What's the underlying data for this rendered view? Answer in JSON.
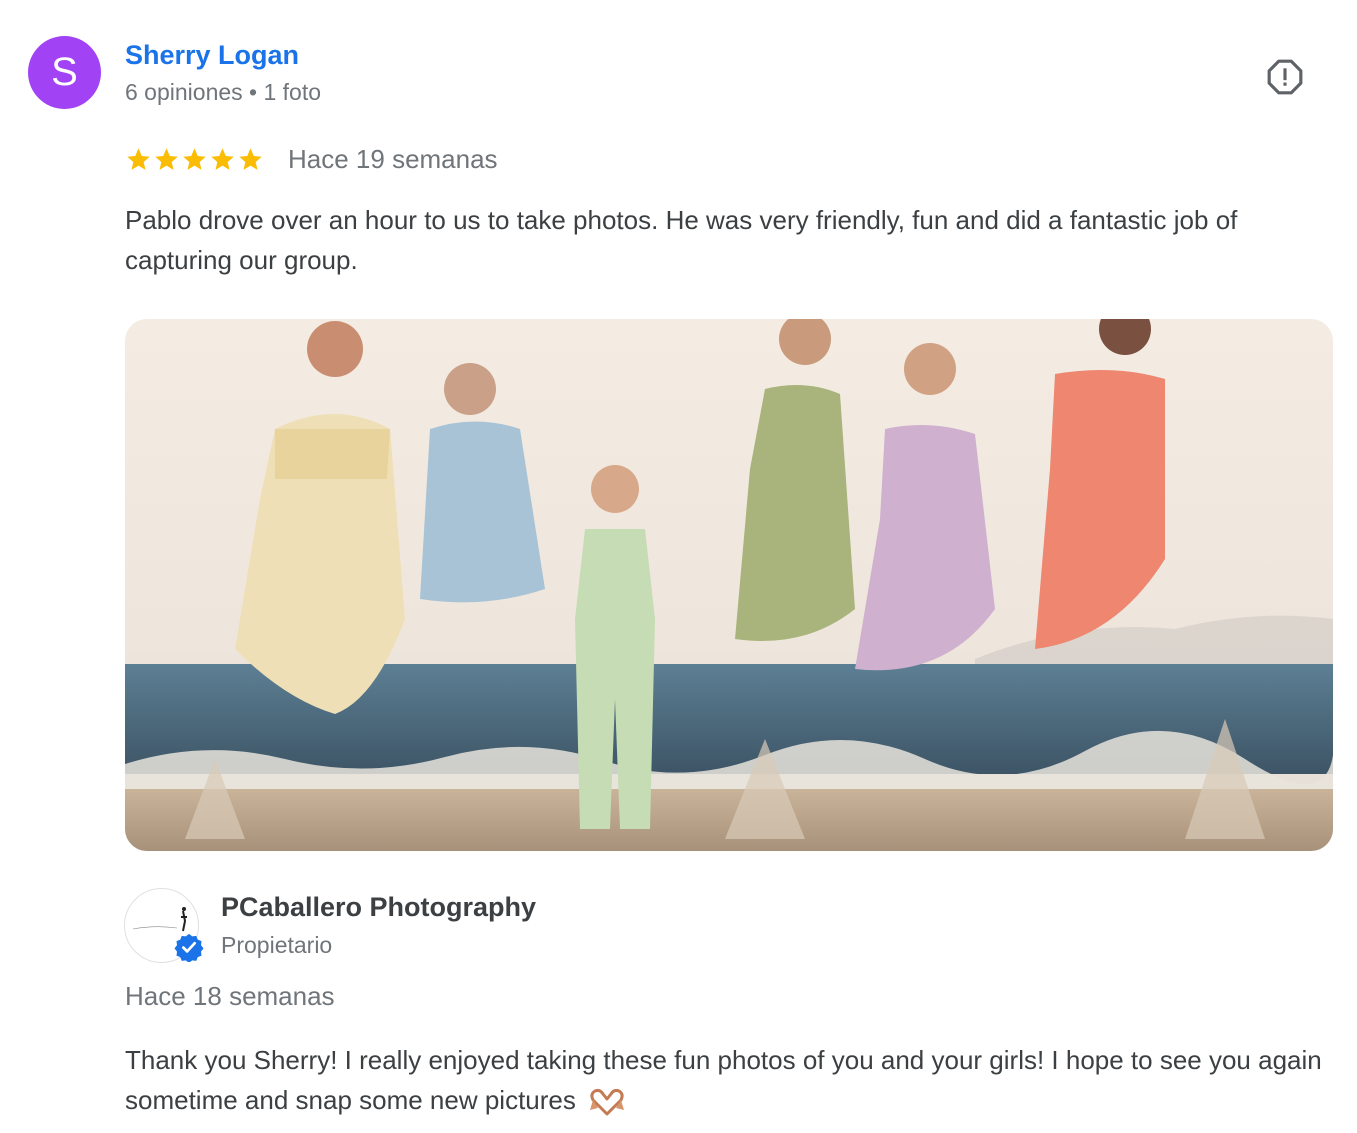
{
  "reviewer": {
    "initial": "S",
    "name": "Sherry Logan",
    "meta": "6 opiniones • 1 foto",
    "avatar_color": "#a142f4"
  },
  "review": {
    "rating": 5,
    "max_rating": 5,
    "time": "Hace 19 semanas",
    "text": "Pablo drove over an hour to us to take photos. He was very friendly, fun and did a fantastic job of capturing our group."
  },
  "report_icon": "report-flag-icon",
  "photo": {
    "icon": "review-photo"
  },
  "owner_reply": {
    "owner_name": "PCaballero Photography",
    "role": "Propietario",
    "time": "Hace 18 semanas",
    "text": "Thank you Sherry! I really enjoyed taking these fun photos of you and your girls! I hope to see you again sometime and snap some new pictures",
    "emoji_icon": "heart-hands-icon",
    "verified_icon": "verified-badge-icon"
  },
  "colors": {
    "link_blue": "#1a73e8",
    "star_yellow": "#fbbc04",
    "text_gray": "#70757a",
    "verified_blue": "#1a73e8"
  }
}
